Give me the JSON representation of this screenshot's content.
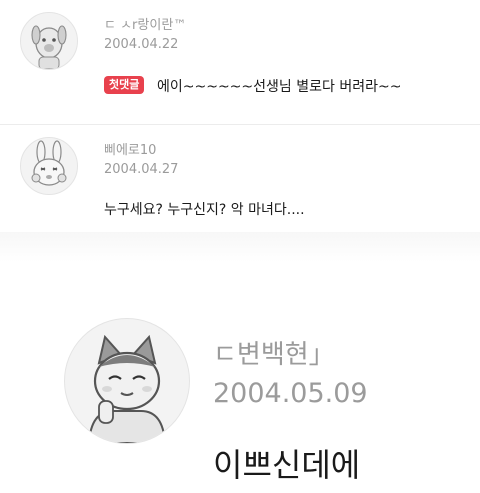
{
  "comments": [
    {
      "name": "ㄷ ㅅr랑이란™",
      "date": "2004.04.22",
      "badge": "첫댓글",
      "text": "에이~~~~~~선생님 별로다 버려라~~",
      "avatar_icon": "dog-avatar-icon"
    },
    {
      "name": "삐에로10",
      "date": "2004.04.27",
      "text": "누구세요? 누구신지? 악 마녀다....",
      "avatar_icon": "rabbit-avatar-icon"
    },
    {
      "name": "ㄷ변백현」",
      "date": "2004.05.09",
      "text": "이쁘신데에",
      "avatar_icon": "cat-avatar-icon"
    }
  ],
  "colors": {
    "badge_bg": "#e8414d",
    "meta_text": "#9b9b9b"
  }
}
